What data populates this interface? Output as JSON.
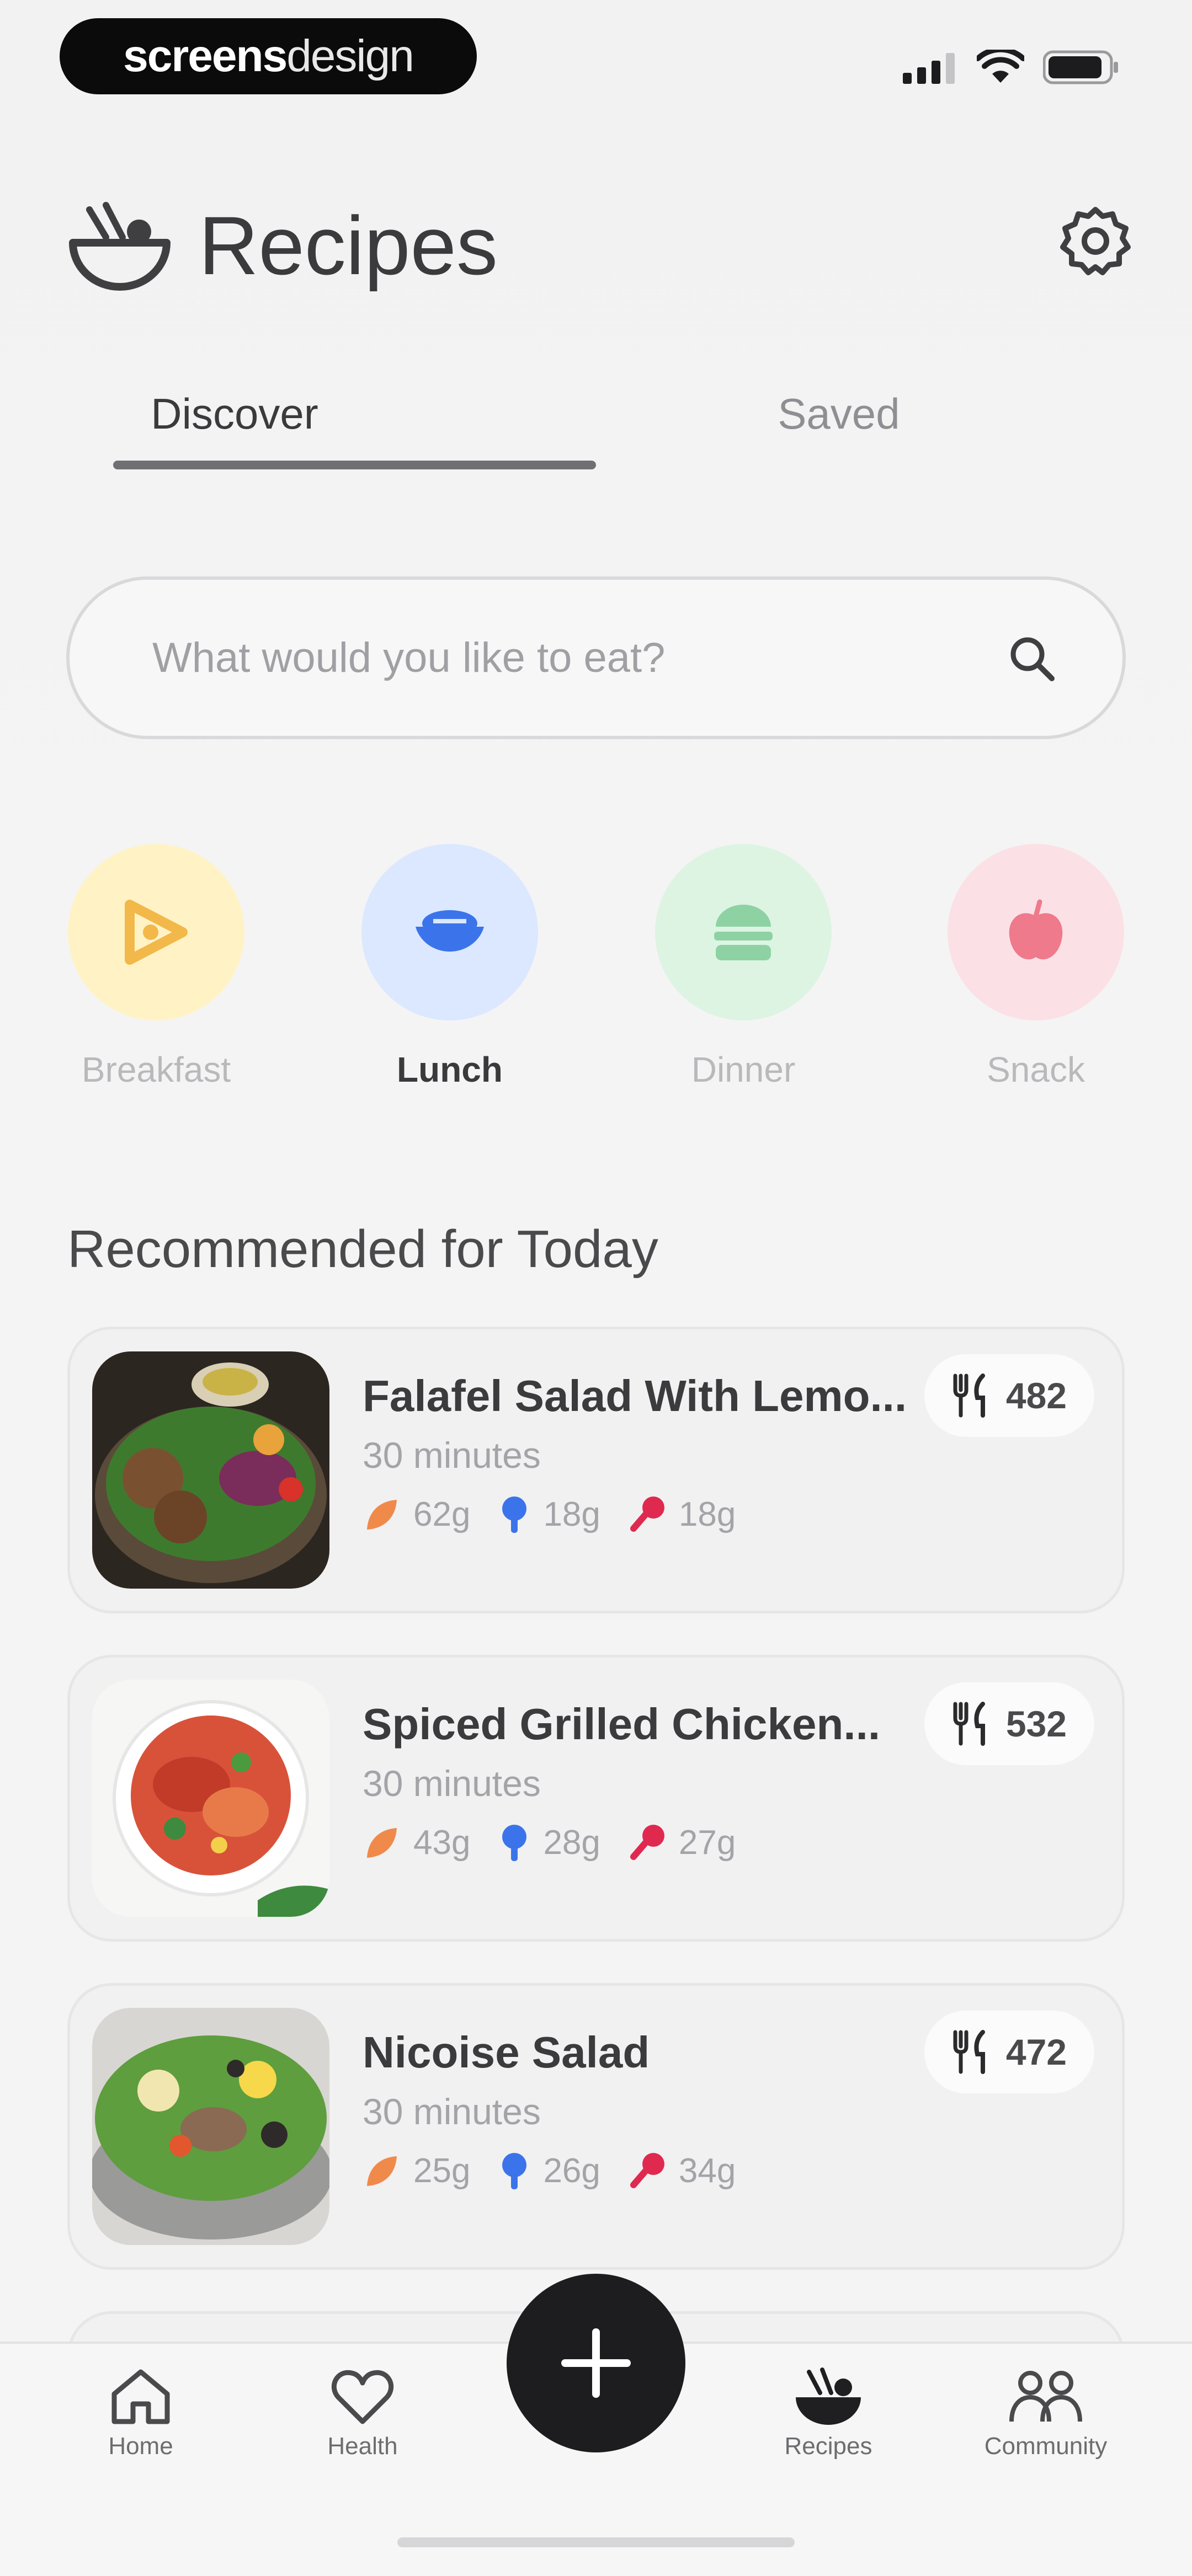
{
  "status_bar": {
    "brand_strong": "screens",
    "brand_light": "design"
  },
  "header": {
    "title": "Recipes"
  },
  "tabs": [
    {
      "label": "Discover",
      "active": true
    },
    {
      "label": "Saved",
      "active": false
    }
  ],
  "search": {
    "placeholder": "What would you like to eat?"
  },
  "categories": [
    {
      "label": "Breakfast",
      "icon": "croissant-icon",
      "color": "#fff3c6",
      "icon_color": "#f2b84a",
      "active": false
    },
    {
      "label": "Lunch",
      "icon": "bowl-icon",
      "color": "#dbe8ff",
      "icon_color": "#3b74ea",
      "active": true
    },
    {
      "label": "Dinner",
      "icon": "burger-icon",
      "color": "#ddf4e3",
      "icon_color": "#8ed2a4",
      "active": false
    },
    {
      "label": "Snack",
      "icon": "apple-icon",
      "color": "#fbe1e5",
      "icon_color": "#ee7a8b",
      "active": false
    }
  ],
  "section_title": "Recommended for Today",
  "recipes": [
    {
      "title": "Falafel Salad With Lemo...",
      "time": "30 minutes",
      "calories": "482",
      "carbs": "62g",
      "protein": "18g",
      "fat": "18g"
    },
    {
      "title": "Spiced Grilled Chicken...",
      "time": "30 minutes",
      "calories": "532",
      "carbs": "43g",
      "protein": "28g",
      "fat": "27g"
    },
    {
      "title": "Nicoise Salad",
      "time": "30 minutes",
      "calories": "472",
      "carbs": "25g",
      "protein": "26g",
      "fat": "34g"
    }
  ],
  "colors": {
    "carbs": "#f08a4b",
    "protein": "#3b74ea",
    "fat": "#e0294f",
    "fab": "#1d1d1f"
  },
  "nav": [
    {
      "label": "Home",
      "icon": "home-icon"
    },
    {
      "label": "Health",
      "icon": "heart-icon"
    },
    {
      "label": "Recipes",
      "icon": "bowl-icon",
      "active": true
    },
    {
      "label": "Community",
      "icon": "people-icon"
    }
  ]
}
